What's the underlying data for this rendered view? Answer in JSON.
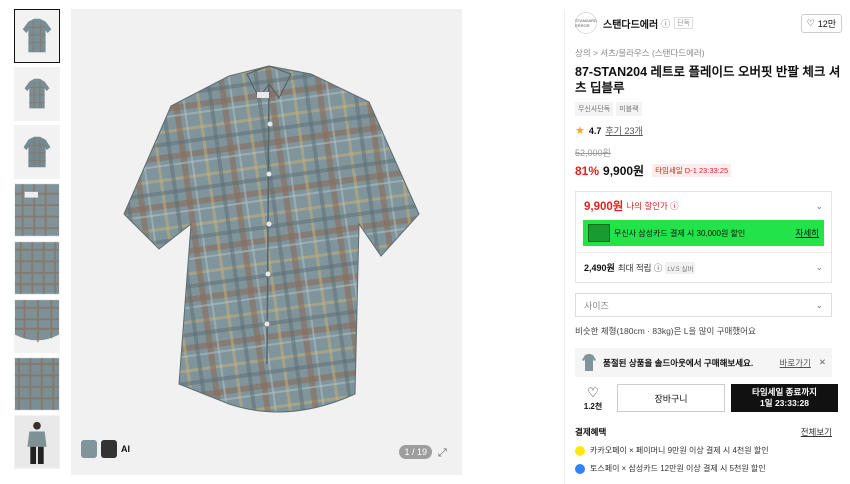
{
  "thumbnails": [
    {
      "label": "shirt-front"
    },
    {
      "label": "shirt-front-small"
    },
    {
      "label": "shirt-side"
    },
    {
      "label": "shirt-detail-collar"
    },
    {
      "label": "shirt-detail-pattern"
    },
    {
      "label": "shirt-detail-hem"
    },
    {
      "label": "shirt-detail-fabric"
    },
    {
      "label": "model-shot"
    }
  ],
  "gallery": {
    "counter": "1 / 19",
    "ai_label": "AI"
  },
  "brand": {
    "logo_text": "STANDARD ERROR",
    "name": "스탠다드에러",
    "info_icon": "ⓘ",
    "tag": "단독",
    "like_icon": "heart-outline-icon",
    "like_count": "12만"
  },
  "breadcrumb": "상의 > 셔츠/블라우스 (스탠다드에러)",
  "product": {
    "title": "87-STAN204 레트로 플레이드 오버핏 반팔 체크 셔츠 딥블루",
    "badges": [
      "무신사단독",
      "미블랙"
    ],
    "rating": "4.7",
    "reviews": "후기 23개",
    "original_price": "52,000원",
    "discount": "81%",
    "price": "9,900원",
    "timesale": "타임세일 D-1 23:33:25"
  },
  "my_price": {
    "price": "9,900원",
    "label": "나의 할인가 ⓘ",
    "card_banner_text": "무신사 삼성카드 결제 시 30,000원 할인",
    "card_banner_link": "자세히",
    "points": "2,490원",
    "points_label": "최대 적립 ⓘ",
    "level_badge": "LV.5 실버"
  },
  "size_select": {
    "placeholder": "사이즈"
  },
  "size_note": "비슷한 체형(180cm · 83kg)은 L을 많이 구매했어요",
  "soldout": {
    "text": "품절된 상품을 솔드아웃에서 구매해보세요.",
    "link": "바로가기",
    "close": "✕"
  },
  "actions": {
    "like_count": "1.2천",
    "cart_label": "장바구니",
    "buy_line1": "타임세일 종료까지",
    "buy_line2": "1일 23:33:28"
  },
  "payment": {
    "title": "결제혜택",
    "all_link": "전체보기",
    "items": [
      {
        "text": "카카오페이 × 페이머니 9만원 이상 결제 시 4천원 할인",
        "color": "#ffe812"
      },
      {
        "text": "토스페이 × 삼성카드 12만원 이상 결제 시 5천원 할인",
        "color": "#3182f6"
      }
    ]
  },
  "colors": {
    "accent_red": "#e52121",
    "card_green": "#22e34a",
    "buy_black": "#111111"
  }
}
